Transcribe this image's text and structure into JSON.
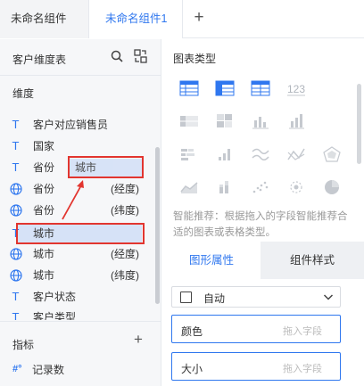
{
  "tabs": [
    {
      "label": "未命名组件",
      "active": false
    },
    {
      "label": "未命名组件1",
      "active": true
    }
  ],
  "add_tab_label": "+",
  "left_panel": {
    "dataset_title": "客户维度表",
    "dimension_title": "维度",
    "fields": [
      {
        "type": "T",
        "icon": "text-type-icon",
        "name": "客户对应销售员",
        "suffix": ""
      },
      {
        "type": "T",
        "icon": "text-type-icon",
        "name": "国家",
        "suffix": ""
      },
      {
        "type": "T",
        "icon": "text-type-icon",
        "name": "省份",
        "suffix": ""
      },
      {
        "type": "geo",
        "icon": "globe-icon",
        "name": "省份",
        "suffix": "(经度)"
      },
      {
        "type": "geo",
        "icon": "globe-icon",
        "name": "省份",
        "suffix": "(纬度)"
      },
      {
        "type": "T",
        "icon": "text-type-icon",
        "name": "城市",
        "suffix": ""
      },
      {
        "type": "geo",
        "icon": "globe-icon",
        "name": "城市",
        "suffix": "(经度)"
      },
      {
        "type": "geo",
        "icon": "globe-icon",
        "name": "城市",
        "suffix": "(纬度)"
      },
      {
        "type": "T",
        "icon": "text-type-icon",
        "name": "客户状态",
        "suffix": ""
      },
      {
        "type": "T",
        "icon": "text-type-icon",
        "name": "客户类型",
        "suffix": ""
      }
    ],
    "dragging_label": "城市",
    "metric_title": "指标",
    "metric_add_label": "+",
    "metric_field": {
      "icon_text": "#°",
      "name": "记录数"
    }
  },
  "right_panel": {
    "chart_type_title": "图表类型",
    "chart_types": [
      "table-icon",
      "cross-table-icon",
      "detail-table-icon",
      "kpi-number-icon",
      "",
      "grouped-table-icon",
      "heatmap-icon",
      "bar-chart-icon",
      "column-chart-icon",
      "",
      "stacked-bar-icon",
      "step-column-icon",
      "line-chart-icon",
      "scatter-line-icon",
      "radar-icon",
      "area-chart-icon",
      "stacked-column-icon",
      "scatter-icon",
      "bubble-icon",
      "pie-chart-icon"
    ],
    "hint": "智能推荐：根据拖入的字段智能推荐合适的图表或表格类型。",
    "attr_tabs": [
      "图形属性",
      "组件样式"
    ],
    "select_value": "自动",
    "props": [
      {
        "label": "颜色",
        "placeholder": "拖入字段"
      },
      {
        "label": "大小",
        "placeholder": "拖入字段"
      }
    ]
  },
  "colors": {
    "accent": "#2f77ef",
    "highlight": "#d6e2f7",
    "annotation": "#e2352f"
  }
}
